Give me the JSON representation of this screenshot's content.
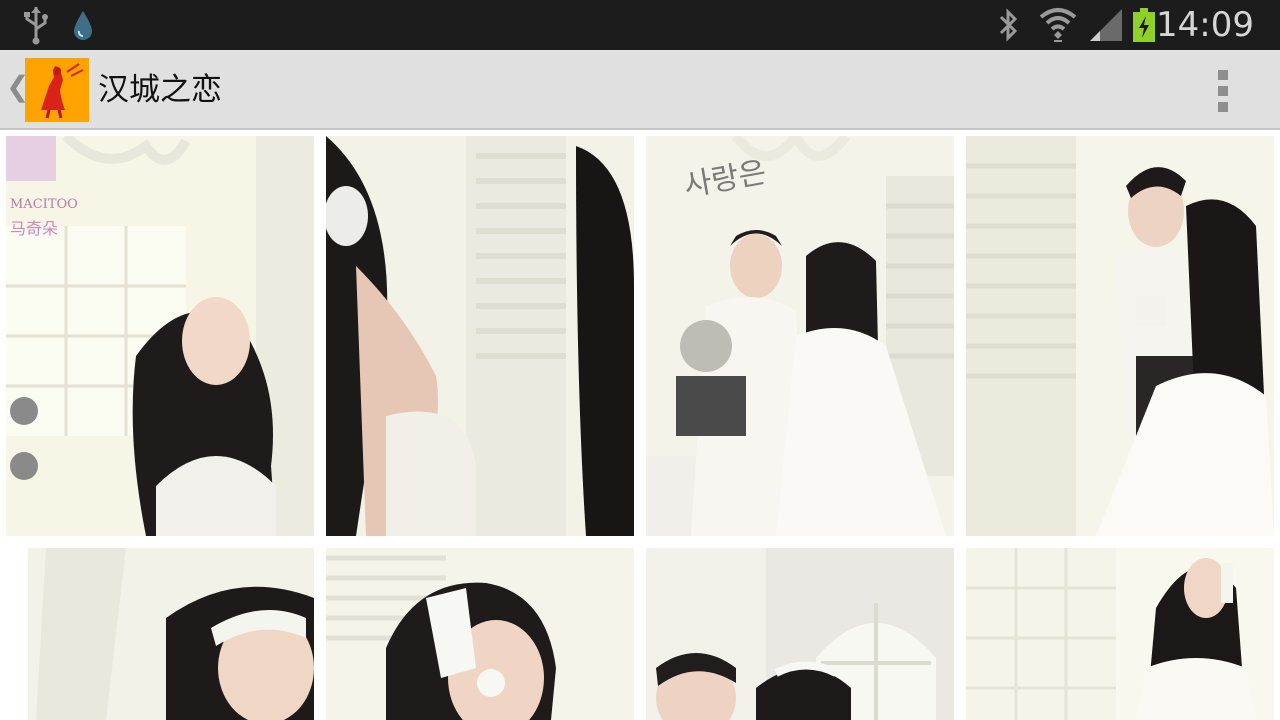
{
  "status_bar": {
    "time": "14:09",
    "icons": [
      "usb-icon",
      "droplet-icon",
      "bluetooth-icon",
      "wifi-icon",
      "signal-icon",
      "battery-charging-icon"
    ]
  },
  "action_bar": {
    "title": "汉城之恋",
    "up_caret": "❮",
    "logo_icon": "couple-logo-icon",
    "overflow_icon": "overflow-menu-icon"
  },
  "gallery": {
    "photos": [
      {
        "watermark": "MACITOO",
        "watermark2": "马奇朵"
      },
      {
        "watermark": ""
      },
      {
        "watermark": "사랑은"
      },
      {
        "watermark": ""
      },
      {
        "watermark": ""
      },
      {
        "watermark": ""
      },
      {
        "watermark": ""
      },
      {
        "watermark": ""
      }
    ]
  },
  "colors": {
    "status_bar": "#1c1c1c",
    "action_bar": "#e0e0e0",
    "logo_bg": "#ffa300",
    "battery": "#8fd12a"
  }
}
